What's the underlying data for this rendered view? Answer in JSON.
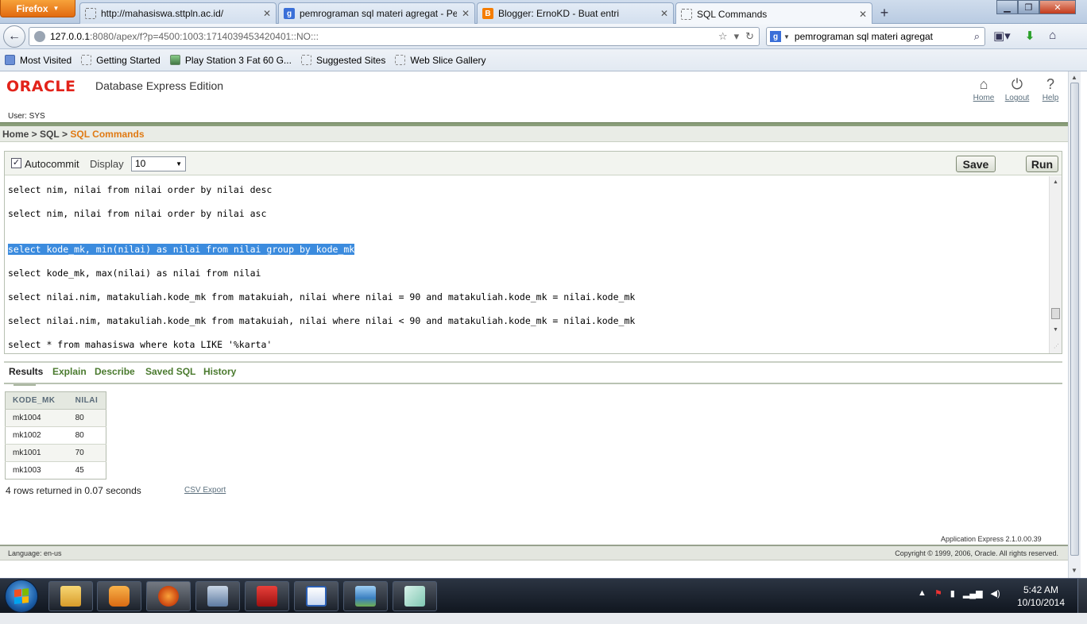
{
  "browser": {
    "menu_button": "Firefox",
    "tabs": [
      {
        "title": "http://mahasiswa.sttpln.ac.id/",
        "icon": "page-icon"
      },
      {
        "title": "pemrograman sql materi agregat - Pe...",
        "icon": "google-icon"
      },
      {
        "title": "Blogger: ErnoKD - Buat entri",
        "icon": "blogger-icon"
      },
      {
        "title": "SQL Commands",
        "icon": "page-icon"
      }
    ],
    "url_host": "127.0.0.1",
    "url_rest": ":8080/apex/f?p=4500:1003:1714039453420401::NO:::",
    "search_value": "pemrograman sql materi agregat",
    "bookmarks": [
      "Most Visited",
      "Getting Started",
      "Play Station 3 Fat 60 G...",
      "Suggested Sites",
      "Web Slice Gallery"
    ]
  },
  "header": {
    "logo": "ORACLE",
    "product": "Database Express Edition",
    "user": "User: SYS",
    "links": {
      "home": "Home",
      "logout": "Logout",
      "help": "Help"
    }
  },
  "breadcrumb": {
    "home": "Home",
    "sep1": " > ",
    "sql": "SQL",
    "sep2": " > ",
    "current": "SQL Commands"
  },
  "toolbar": {
    "autocommit_label": "Autocommit",
    "autocommit_checked": true,
    "display_label": "Display",
    "display_value": "10",
    "save_label": "Save",
    "run_label": "Run"
  },
  "editor": {
    "lines": [
      "select nim, nilai from nilai order by nilai desc",
      "select nim, nilai from nilai order by nilai asc",
      "select kode_mk, min(nilai) as nilai from nilai group by kode_mk",
      "select kode_mk, max(nilai) as nilai from nilai",
      "select nilai.nim, matakuliah.kode_mk from matakuiah, nilai where nilai = 90 and matakuliah.kode_mk = nilai.kode_mk",
      "select nilai.nim, matakuliah.kode_mk from matakuiah, nilai where nilai < 90 and matakuliah.kode_mk = nilai.kode_mk",
      "select * from mahasiswa where kota LIKE '%karta'"
    ],
    "selected_line": 2
  },
  "result_tabs": [
    "Results",
    "Explain",
    "Describe",
    "Saved SQL",
    "History"
  ],
  "results": {
    "columns": [
      "KODE_MK",
      "NILAI"
    ],
    "rows": [
      [
        "mk1004",
        "80"
      ],
      [
        "mk1002",
        "80"
      ],
      [
        "mk1001",
        "70"
      ],
      [
        "mk1003",
        "45"
      ]
    ],
    "summary": "4 rows returned in 0.07 seconds",
    "csv_export": "CSV Export"
  },
  "footer": {
    "apex_version": "Application Express 2.1.0.00.39",
    "language": "Language: en-us",
    "copyright": "Copyright © 1999, 2006, Oracle. All rights reserved."
  },
  "taskbar": {
    "time": "5:42 AM",
    "date": "10/10/2014",
    "apps": [
      "explorer-icon",
      "media-player-icon",
      "firefox-icon",
      "app-icon",
      "acrobat-icon",
      "word-icon",
      "photo-viewer-icon",
      "notepad-icon"
    ]
  },
  "colors": {
    "oracle_red": "#e2231a",
    "breadcrumb_current": "#e07a13",
    "tab_link_green": "#4a7a2e",
    "selection_blue": "#3b8bde"
  }
}
